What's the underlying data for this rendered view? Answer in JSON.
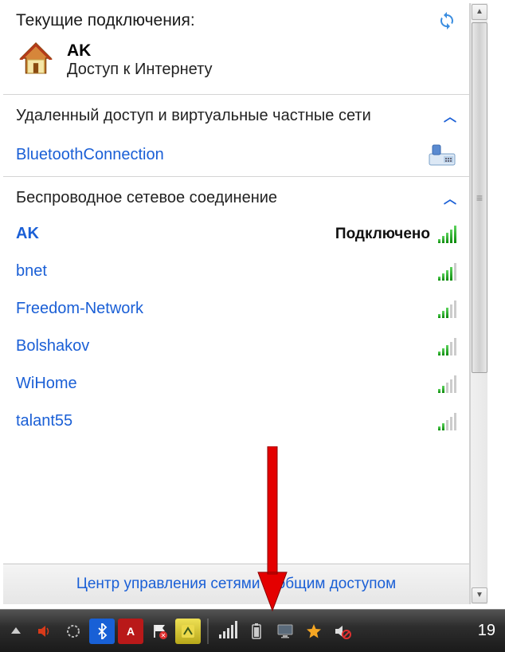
{
  "header": {
    "title": "Текущие подключения:"
  },
  "current_connection": {
    "name": "AK",
    "status": "Доступ к Интернету"
  },
  "categories": {
    "dialup": {
      "title": "Удаленный доступ и виртуальные частные сети",
      "items": [
        {
          "name": "BluetoothConnection"
        }
      ]
    },
    "wireless": {
      "title": "Беспроводное сетевое соединение",
      "items": [
        {
          "name": "AK",
          "status": "Подключено",
          "signal": 5
        },
        {
          "name": "bnet",
          "signal": 4
        },
        {
          "name": "Freedom-Network",
          "signal": 3
        },
        {
          "name": "Bolshakov",
          "signal": 3
        },
        {
          "name": "WiHome",
          "signal": 2
        },
        {
          "name": "talant55",
          "signal": 2
        }
      ]
    }
  },
  "footer_link": "Центр управления сетями и общим доступом",
  "taskbar": {
    "time": "19"
  }
}
